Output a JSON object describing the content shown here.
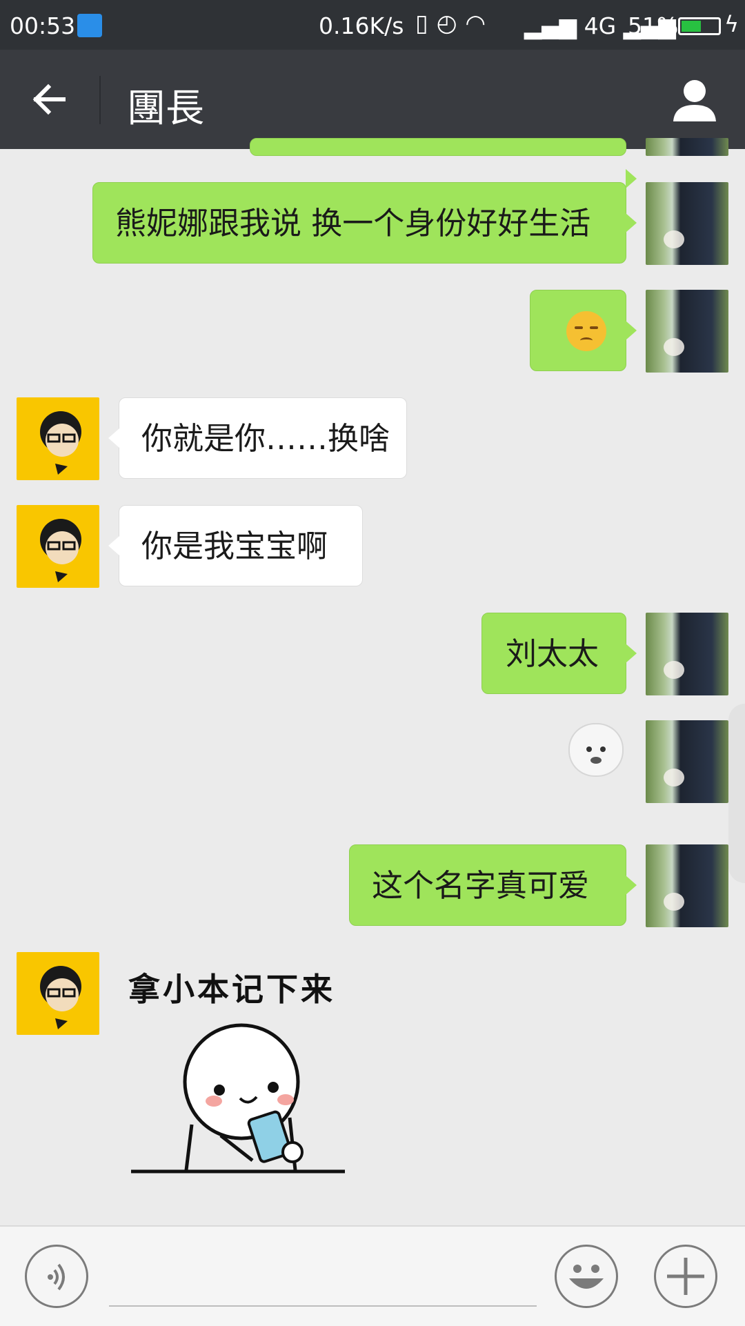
{
  "status_bar": {
    "time": "00:53",
    "net_speed": "0.16K/s",
    "network": "4G",
    "battery_pct": "51%",
    "battery_level": 0.51,
    "icons": [
      "vibrate-icon",
      "alarm-icon",
      "wifi-icon",
      "signal-icon",
      "signal-icon",
      "battery-icon",
      "charging-icon"
    ]
  },
  "header": {
    "title": "團長",
    "back_icon": "back-arrow-icon",
    "profile_icon": "person-icon"
  },
  "messages": [
    {
      "side": "right",
      "type": "text",
      "text": "熊妮娜跟我说 换一个身份好好生活"
    },
    {
      "side": "right",
      "type": "emoji",
      "emoji": "pensive-face"
    },
    {
      "side": "left",
      "type": "text",
      "text": "你就是你……换啥"
    },
    {
      "side": "left",
      "type": "text",
      "text": "你是我宝宝啊"
    },
    {
      "side": "right",
      "type": "text",
      "text": "刘太太"
    },
    {
      "side": "right",
      "type": "sticker",
      "sticker": "round-face-sticker"
    },
    {
      "side": "right",
      "type": "text",
      "text": "这个名字真可爱"
    },
    {
      "side": "left",
      "type": "sticker",
      "sticker": "note-taking-sticker",
      "caption": "拿小本记下来"
    }
  ],
  "input_bar": {
    "voice_icon": "voice-icon",
    "emoji_icon": "smiley-icon",
    "more_icon": "plus-icon"
  },
  "colors": {
    "status_bg": "#2f3236",
    "header_bg": "#393b40",
    "chat_bg": "#ebebeb",
    "bubble_green": "#9fe45b",
    "bubble_white": "#ffffff",
    "battery_green": "#28c141"
  }
}
